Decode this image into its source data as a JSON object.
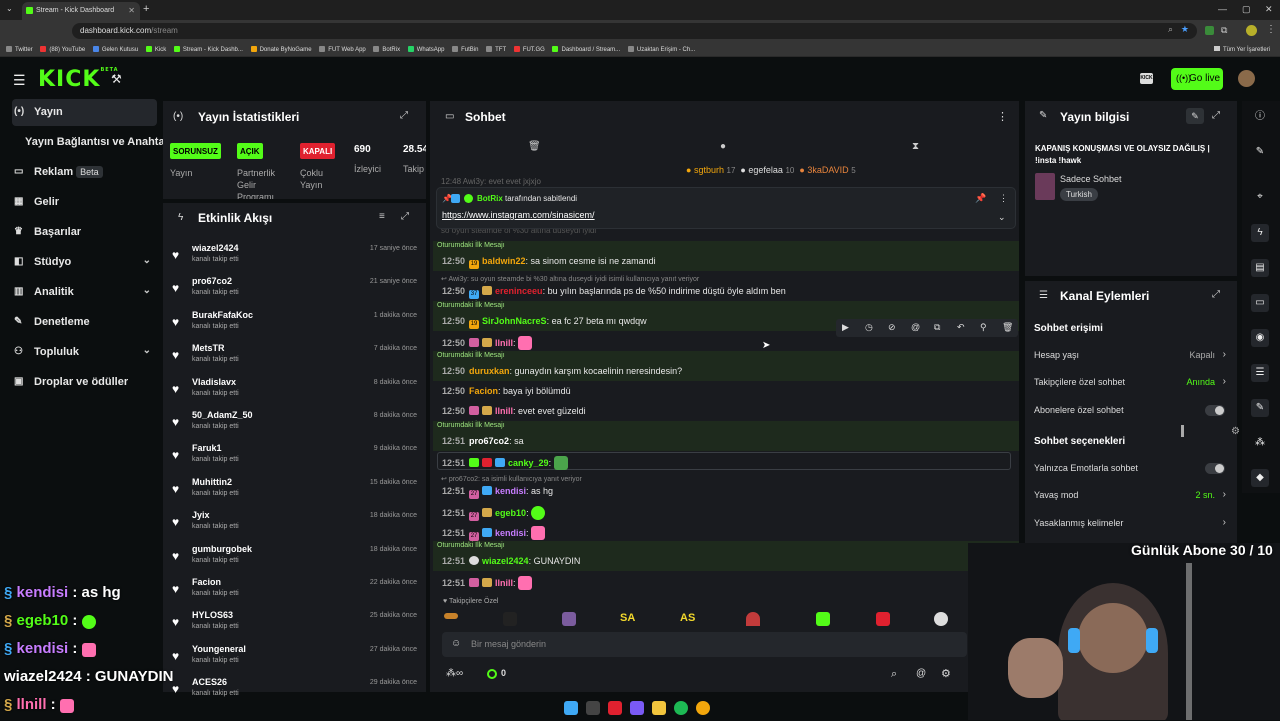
{
  "browser": {
    "tab_title": "Stream - Kick Dashboard",
    "url_host": "dashboard.kick.com",
    "url_path": "/stream",
    "bookmarks": [
      "Twitter",
      "(88) YouTube",
      "Gelen Kutusu",
      "Kick",
      "Stream - Kick Dashb...",
      "Donate ByNoGame",
      "FUT Web App",
      "BotRix",
      "WhatsApp",
      "FutBin",
      "TFT",
      "FUT.GG",
      "Dashboard / Stream...",
      "Uzaktan Erişim - Ch..."
    ],
    "all_bookmarks": "Tüm Yer İşaretleri"
  },
  "header": {
    "logo": "KICK",
    "logo_tag": "BETA",
    "go_live": "Go live"
  },
  "nav": {
    "items": [
      {
        "label": "Yayın",
        "icon": "broadcast-icon"
      },
      {
        "label": "Yayın Bağlantısı ve Anahtarı",
        "icon": ""
      },
      {
        "label": "Reklam",
        "icon": "tv-icon",
        "badge": "Beta"
      },
      {
        "label": "Gelir",
        "icon": "grid-icon"
      },
      {
        "label": "Başarılar",
        "icon": "trophy-icon"
      },
      {
        "label": "Stüdyo",
        "icon": "layers-icon"
      },
      {
        "label": "Analitik",
        "icon": "chart-icon"
      },
      {
        "label": "Denetleme",
        "icon": "wrench-icon"
      },
      {
        "label": "Topluluk",
        "icon": "people-icon"
      },
      {
        "label": "Droplar ve ödüller",
        "icon": "gift-icon"
      }
    ]
  },
  "stats": {
    "title": "Yayın İstatistikleri",
    "badges": [
      {
        "label": "SORUNSUZ",
        "caption": "Yayın",
        "color": "#53fc18"
      },
      {
        "label": "AÇIK",
        "caption": "Partnerlik Gelir Programı",
        "color": "#53fc18"
      },
      {
        "label": "KAPALI",
        "caption": "Çoklu Yayın",
        "color": "#e0212f"
      }
    ],
    "viewers": "690",
    "viewers_label": "İzleyici",
    "followers": "28.54",
    "followers_label": "Takip"
  },
  "activity": {
    "title": "Etkinlik Akışı",
    "subtitle": "kanalı takip etti",
    "rows": [
      {
        "name": "wiazel2424",
        "time": "17 saniye önce"
      },
      {
        "name": "pro67co2",
        "time": "21 saniye önce"
      },
      {
        "name": "BurakFafaKoc",
        "time": "1 dakika önce"
      },
      {
        "name": "MetsTR",
        "time": "7 dakika önce"
      },
      {
        "name": "Vladislavx",
        "time": "8 dakika önce"
      },
      {
        "name": "50_AdamZ_50",
        "time": "8 dakika önce"
      },
      {
        "name": "Faruk1",
        "time": "9 dakika önce"
      },
      {
        "name": "Muhittin2",
        "time": "15 dakika önce"
      },
      {
        "name": "Jyix",
        "time": "18 dakika önce"
      },
      {
        "name": "gumburgobek",
        "time": "18 dakika önce"
      },
      {
        "name": "Facion",
        "time": "22 dakika önce"
      },
      {
        "name": "HYLOS63",
        "time": "25 dakika önce"
      },
      {
        "name": "Youngeneral",
        "time": "27 dakika önce"
      },
      {
        "name": "ACES26",
        "time": "29 dakika önce"
      }
    ]
  },
  "chat": {
    "title": "Sohbet",
    "top_gifters": [
      {
        "name": "sgtburh",
        "count": "17"
      },
      {
        "name": "egefelaa",
        "count": "10"
      },
      {
        "name": "3kaDAVID",
        "count": "5"
      }
    ],
    "pinned_by_prefix": "BotRix",
    "pinned_by_suffix": "tarafından sabitlendi",
    "pinned_link": "https://www.instagram.com/sinasicem/",
    "faded_top": "12:48 Awi3y: evet evet jxjxjo",
    "faded_mid": "so oyun steamde ol %30 altına düseydi iyidi",
    "first_msg_label": "Oturumdaki İlk Mesajı",
    "messages": [
      {
        "time": "12:50",
        "user": "baldwin22",
        "color": "#f2a60c",
        "text": ": sa sinom cesme isi ne zamandi"
      },
      {
        "time": "12:50",
        "user": "ereninceeu",
        "color": "#e0212f",
        "text": ": bu yılın başlarında ps de %50 indirime düştü öyle aldım ben"
      },
      {
        "time": "12:50",
        "user": "SirJohnNacreS",
        "color": "#53fc18",
        "text": ": ea fc 27 beta mı qwdqw"
      },
      {
        "time": "12:50",
        "user": "llnill",
        "color": "#ff6fb0",
        "text": ":"
      },
      {
        "time": "12:50",
        "user": "duruxkan",
        "color": "#f2a60c",
        "text": ": gunaydın karşım kocaelinin neresindesin?"
      },
      {
        "time": "12:50",
        "user": "Facion",
        "color": "#f2a60c",
        "text": ": baya iyi bölümdü"
      },
      {
        "time": "12:50",
        "user": "llnill",
        "color": "#ff6fb0",
        "text": ": evet evet güzeldi"
      },
      {
        "time": "12:51",
        "user": "pro67co2",
        "color": "#ffffff",
        "text": ": sa"
      },
      {
        "time": "12:51",
        "user": "canky_29",
        "color": "#53fc18",
        "text": ":"
      },
      {
        "time": "12:51",
        "user": "kendisi",
        "color": "#c77dff",
        "text": ": as hg"
      },
      {
        "time": "12:51",
        "user": "egeb10",
        "color": "#53fc18",
        "text": ":"
      },
      {
        "time": "12:51",
        "user": "kendisi",
        "color": "#c77dff",
        "text": ":"
      },
      {
        "time": "12:51",
        "user": "wiazel2424",
        "color": "#53fc18",
        "text": ": GUNAYDIN"
      },
      {
        "time": "12:51",
        "user": "llnill",
        "color": "#ff6fb0",
        "text": ":"
      }
    ],
    "reply_awi3y": "Awi3y: su oyun steamde bi %30 altına duseydi iyidi isimli kullanıcıya yanıt veriyor",
    "reply_pro": "pro67co2: sa isimli kullanıcıya yanıt veriyor",
    "followers_only": "Takipçilere Özel",
    "emote_labels": [
      "SA",
      "AS"
    ],
    "input_placeholder": "Bir mesaj gönderin",
    "footer_count": "0"
  },
  "stream_info": {
    "title": "Yayın bilgisi",
    "stream_title": "KAPANIŞ KONUŞMASI VE OLAYSIZ DAĞILIŞ | !insta !hawk",
    "category": "Sadece Sohbet",
    "language": "Turkish"
  },
  "channel_actions": {
    "title": "Kanal Eylemleri",
    "chat_access": "Sohbet erişimi",
    "account_age": "Hesap yaşı",
    "account_age_val": "Kapalı",
    "followers_only": "Takipçilere özel sohbet",
    "followers_only_val": "Anında",
    "subs_only": "Abonelere özel sohbet",
    "chat_options": "Sohbet seçenekleri",
    "emotes_only": "Yalnızca Emotlarla sohbet",
    "slow_mode": "Yavaş mod",
    "slow_mode_val": "2 sn.",
    "banned_words": "Yasaklanmış kelimeler"
  },
  "overlay": {
    "goal": "Günlük Abone 30 / 10",
    "lines": [
      {
        "user": "kendisi",
        "text": " : as hg",
        "color": "#c77dff"
      },
      {
        "user": "egeb10",
        "text": " : ",
        "color": "#53fc18"
      },
      {
        "user": "kendisi",
        "text": " : ",
        "color": "#c77dff"
      },
      {
        "user": "wiazel2424",
        "text": " : GUNAYDIN",
        "color": "#ffffff"
      },
      {
        "user": "llnill",
        "text": " : ",
        "color": "#ff6fb0"
      }
    ]
  },
  "colors": {
    "accent": "#53fc18",
    "panel": "#191b1f",
    "bg": "#0b0e0f",
    "danger": "#e0212f"
  }
}
